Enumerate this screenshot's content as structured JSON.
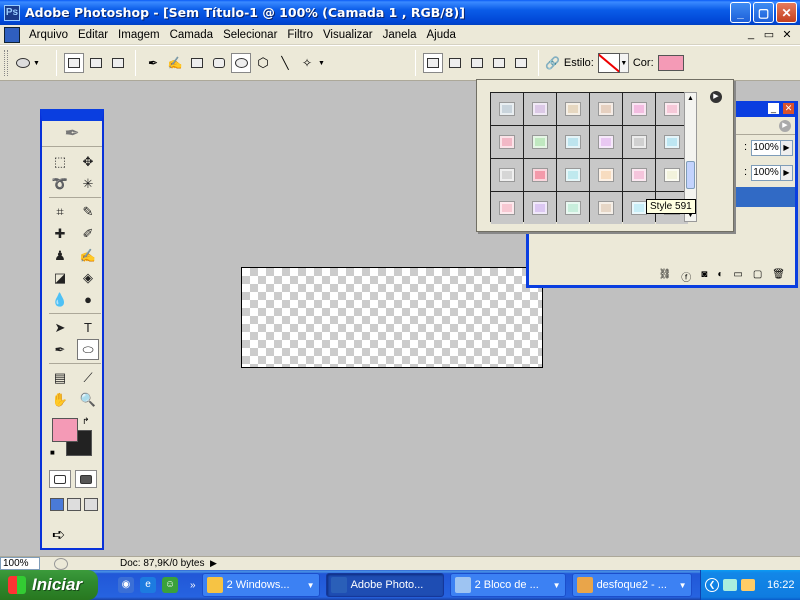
{
  "window": {
    "title": "Adobe Photoshop - [Sem Título-1 @ 100% (Camada 1 , RGB/8)]",
    "buttons": {
      "minimize": "_",
      "maximize": "▢",
      "close": "✕"
    }
  },
  "menubar": {
    "items": [
      "Arquivo",
      "Editar",
      "Imagem",
      "Camada",
      "Selecionar",
      "Filtro",
      "Visualizar",
      "Janela",
      "Ajuda"
    ],
    "mdi": {
      "minimize": "_",
      "restore": "▭",
      "close": "✕"
    }
  },
  "options": {
    "estilo_label": "Estilo:",
    "cor_label": "Cor:",
    "cor_color": "#f49ab6"
  },
  "toolbox": {
    "tools": [
      {
        "name": "marquee-tool-icon",
        "glyph": "⬚"
      },
      {
        "name": "move-tool-icon",
        "glyph": "✥"
      },
      {
        "name": "lasso-tool-icon",
        "glyph": "➰"
      },
      {
        "name": "magic-wand-tool-icon",
        "glyph": "✳"
      },
      {
        "name": "crop-tool-icon",
        "glyph": "⌗"
      },
      {
        "name": "slice-tool-icon",
        "glyph": "✎"
      },
      {
        "name": "healing-brush-tool-icon",
        "glyph": "✚"
      },
      {
        "name": "brush-tool-icon",
        "glyph": "✐"
      },
      {
        "name": "clone-stamp-tool-icon",
        "glyph": "♟"
      },
      {
        "name": "history-brush-tool-icon",
        "glyph": "✍"
      },
      {
        "name": "eraser-tool-icon",
        "glyph": "◪"
      },
      {
        "name": "paint-bucket-tool-icon",
        "glyph": "◈"
      },
      {
        "name": "blur-tool-icon",
        "glyph": "💧"
      },
      {
        "name": "dodge-tool-icon",
        "glyph": "●"
      },
      {
        "name": "path-selection-tool-icon",
        "glyph": "➤"
      },
      {
        "name": "type-tool-icon",
        "glyph": "T"
      },
      {
        "name": "pen-tool-icon",
        "glyph": "✒"
      },
      {
        "name": "ellipse-tool-icon",
        "glyph": "⬭"
      },
      {
        "name": "notes-tool-icon",
        "glyph": "▤"
      },
      {
        "name": "eyedropper-tool-icon",
        "glyph": "⟋"
      },
      {
        "name": "hand-tool-icon",
        "glyph": "✋"
      },
      {
        "name": "zoom-tool-icon",
        "glyph": "🔍"
      }
    ],
    "foreground_color": "#f49ab6",
    "background_color": "#222222"
  },
  "style_picker": {
    "swatches": [
      "#c9d4dc",
      "#dcc9e6",
      "#e6d7c0",
      "#e6d0c0",
      "#f3bde1",
      "#f6c8d8",
      "#f2b8c6",
      "#c0e8c0",
      "#bde4ee",
      "#e9c8f2",
      "#d0d0d0",
      "#bde6f2",
      "#d6d6d6",
      "#f39aaa",
      "#bfe9ee",
      "#f7dcc0",
      "#f5c5dc",
      "#f2f2dc",
      "#f7c8d2",
      "#dcc8f2",
      "#c8eedc",
      "#e6d6c6",
      "#c8eef7",
      "#d8d8d8"
    ],
    "tooltip": "Style 591",
    "menu_glyph": "▶"
  },
  "layers": {
    "opacity": "100%",
    "fill": "100%"
  },
  "statusbar": {
    "zoom": "100%",
    "doc_info": "Doc: 87,9K/0 bytes"
  },
  "taskbar": {
    "start_label": "Iniciar",
    "tasks": [
      {
        "label": "2 Windows...",
        "color": "#f6c344",
        "active": false
      },
      {
        "label": "Adobe Photo...",
        "color": "#2a5fb8",
        "active": true
      },
      {
        "label": "2 Bloco de ...",
        "color": "#9ec4f2",
        "active": false
      },
      {
        "label": "desfoque2 - ...",
        "color": "#e9a54a",
        "active": false
      }
    ],
    "clock": "16:22"
  }
}
